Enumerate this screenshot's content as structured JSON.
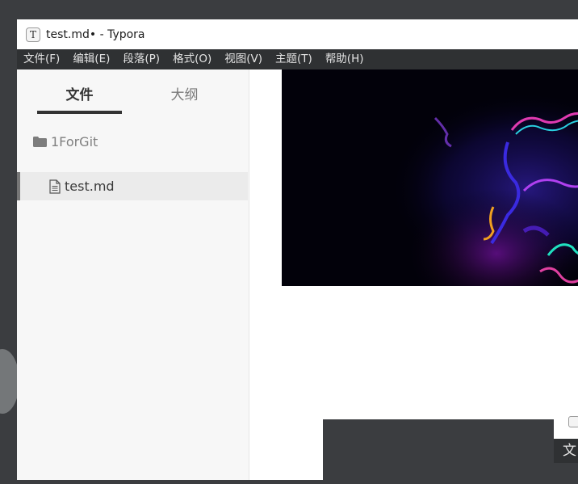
{
  "window": {
    "title": "test.md• - Typora",
    "app_icon_glyph": "T"
  },
  "menubar": {
    "items": [
      {
        "label": "文件(F)"
      },
      {
        "label": "编辑(E)"
      },
      {
        "label": "段落(P)"
      },
      {
        "label": "格式(O)"
      },
      {
        "label": "视图(V)"
      },
      {
        "label": "主题(T)"
      },
      {
        "label": "帮助(H)"
      }
    ]
  },
  "sidebar": {
    "tabs": [
      {
        "label": "文件",
        "active": true
      },
      {
        "label": "大纲",
        "active": false
      }
    ],
    "tree": {
      "folder": {
        "label": "1ForGit",
        "icon": "folder-icon"
      },
      "files": [
        {
          "label": "test.md",
          "icon": "document-icon",
          "active": true
        }
      ]
    }
  },
  "editor": {
    "image": {
      "kind": "abstract neon fluid image"
    }
  },
  "background_window": {
    "menu_fragment": "文"
  },
  "colors": {
    "menubar_bg": "#2f3133",
    "sidebar_bg": "#f7f7f7",
    "active_file_bg": "#ebebeb",
    "desktop_bg": "#3b3d40"
  }
}
